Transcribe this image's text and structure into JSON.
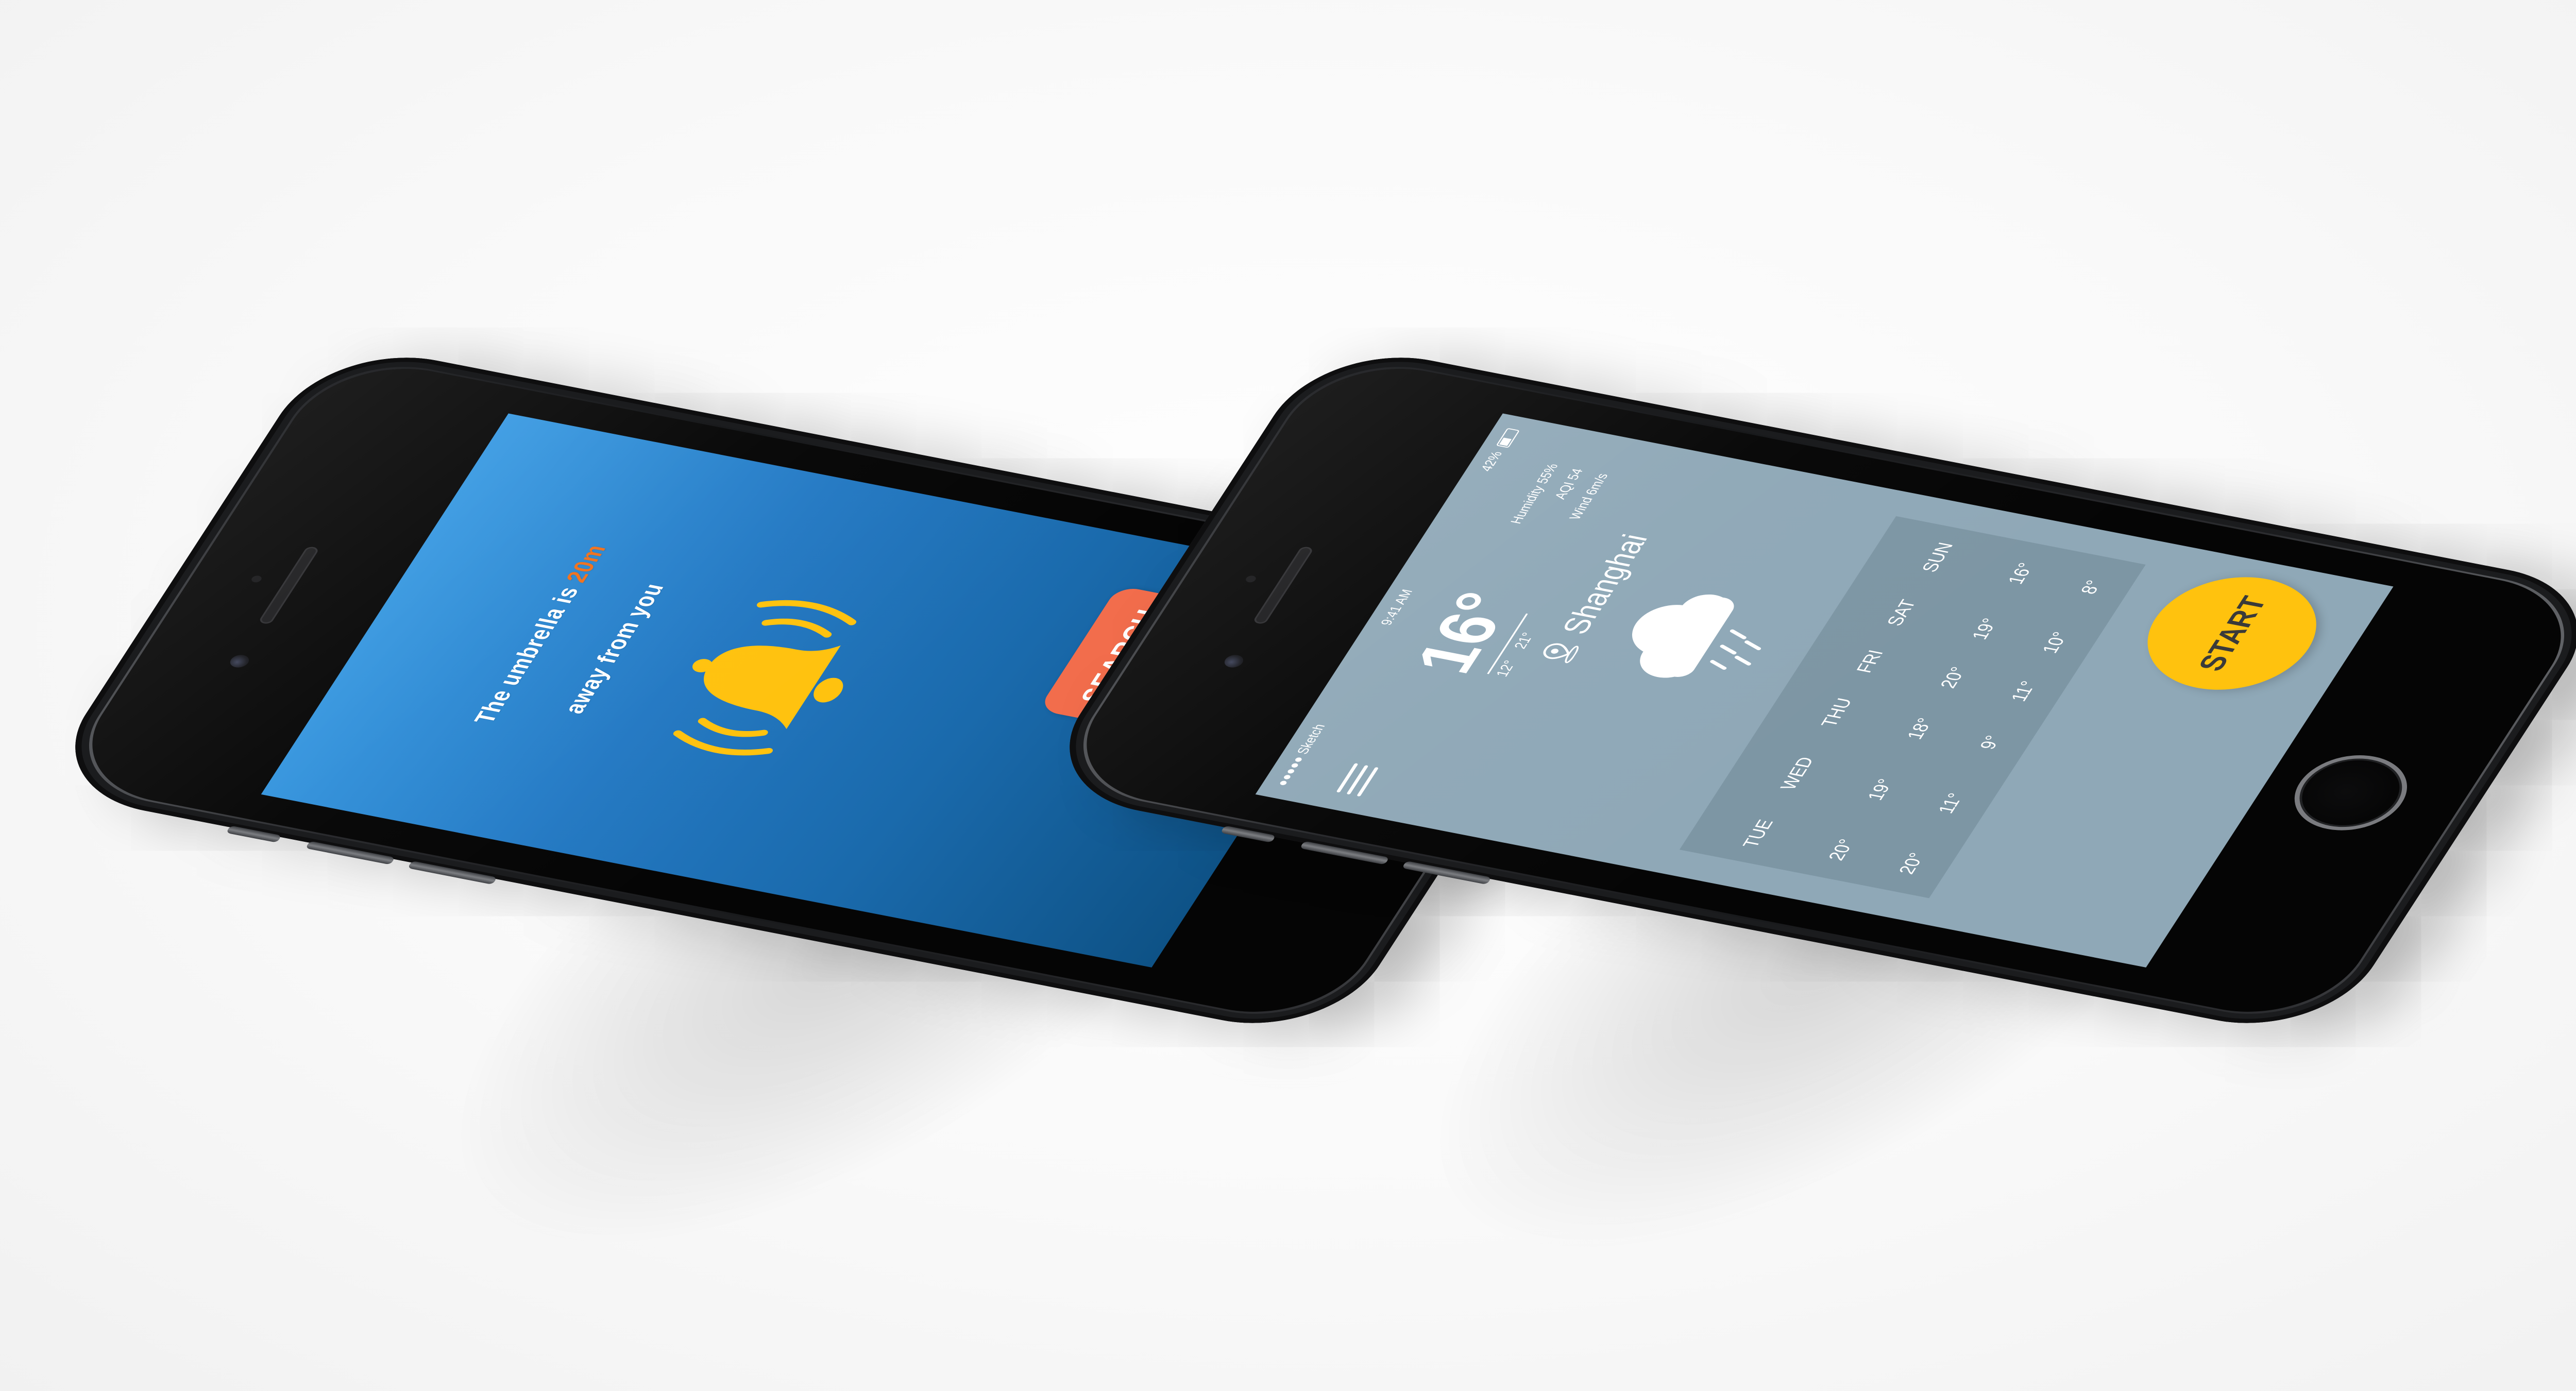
{
  "umbrella_app": {
    "line1_prefix": "The umbrella is ",
    "distance": "20m",
    "line2": "away from you",
    "search_label": "SEARCH",
    "colors": {
      "background_top": "#3799e2",
      "background_bottom": "#0e5286",
      "accent": "#f0711c",
      "button": "#f26d4c",
      "bell": "#ffc20e"
    },
    "icons": [
      "bell-icon",
      "sound-wave-icon"
    ]
  },
  "weather_app": {
    "status_bar": {
      "carrier": "●●●●● Sketch",
      "time": "9:41 AM",
      "battery": "42%",
      "battery_level": 0.42
    },
    "temperature": "16°",
    "temp_low": "12°",
    "temp_high": "21°",
    "stats": {
      "humidity": "Humidity  55%",
      "aqi": "AQI  54",
      "wind": "Wind  6m/s"
    },
    "location": "Shanghai",
    "icons": [
      "menu-icon",
      "location-pin-icon",
      "rain-cloud-icon"
    ],
    "forecast": {
      "days": [
        "TUE",
        "WED",
        "THU",
        "FRI",
        "SAT",
        "SUN"
      ],
      "highs": [
        "20°",
        "19°",
        "18°",
        "20°",
        "19°",
        "16°"
      ],
      "lows": [
        "20°",
        "11°",
        "9°",
        "11°",
        "10°",
        "8°"
      ]
    },
    "start_label": "START",
    "colors": {
      "background": "#8fa8b7",
      "panel": "#6f8796",
      "button": "#ffc20e",
      "button_text": "#3a3a3a"
    }
  }
}
